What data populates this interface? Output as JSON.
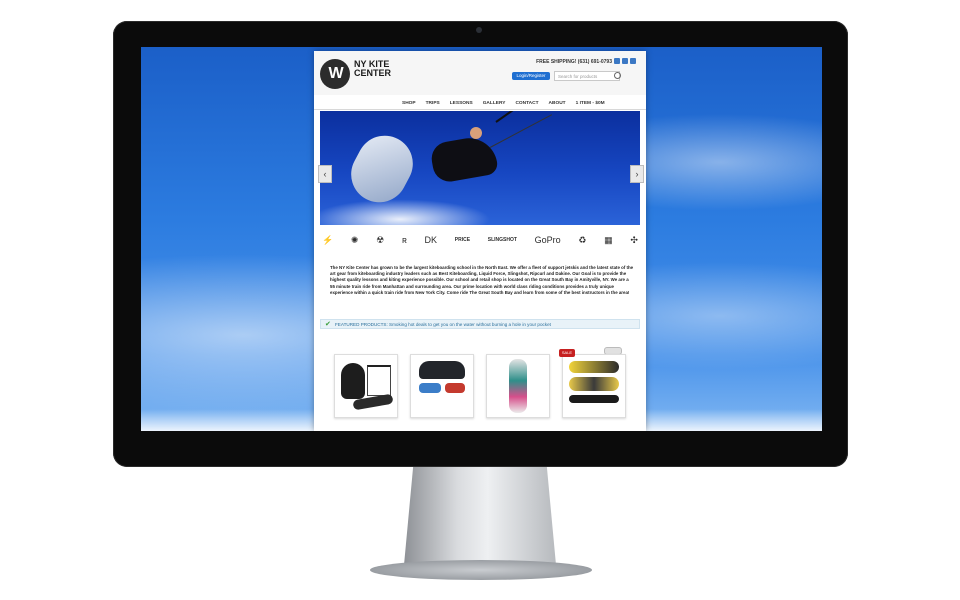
{
  "site": {
    "logo_text": "NY KITE CENTER",
    "free_shipping": "FREE SHIPPING! (631) 691-0793",
    "login_label": "Login/Register",
    "search_placeholder": "Search for products",
    "nav": [
      "SHOP",
      "TRIPS",
      "LESSONS",
      "GALLERY",
      "CONTACT",
      "ABOUT",
      "1 ITEM - $0M"
    ],
    "hero": {
      "prev_arrow": "‹",
      "next_arrow": "›"
    },
    "brands": [
      "⚡",
      "✺",
      "☢",
      "ʀ",
      "DK",
      "PRICE",
      "SLINGSHOT",
      "GoPro",
      "♻",
      "▦",
      "✣"
    ],
    "intro_text": "The NY Kite Center has grown to be the largest kiteboarding school in the North East. We offer a fleet of support jetskis and the latest state of the art gear from kiteboarding industry leaders such as Best Kiteboarding, Liquid Force, Slingshot, Ripcurl and Dakine. Our Goal is to provide the highest quality lessons and kiting experience possible. Our school and retail shop is located on the Great South Bay in Amityville, NY. We are a 55 minute train ride from Manhattan and surrounding area. Our prime location with world class riding conditions provides a truly unique experience within a quick train ride from New York City. Come ride The Great South Bay and learn from some of the best instructors in the area!",
    "featured_text": "FEATURED PRODUCTS: Smoking hot deals to get you on the water without burning a hole in your pocket",
    "sale_badge": "SALE"
  },
  "colors": {
    "login_button": "#1f6fd1",
    "featured_bg": "#e8f2f8",
    "sale_badge": "#c62020"
  },
  "icons": {
    "device_logo": "apple-logo-icon",
    "check": "check-icon",
    "search": "search-icon"
  }
}
